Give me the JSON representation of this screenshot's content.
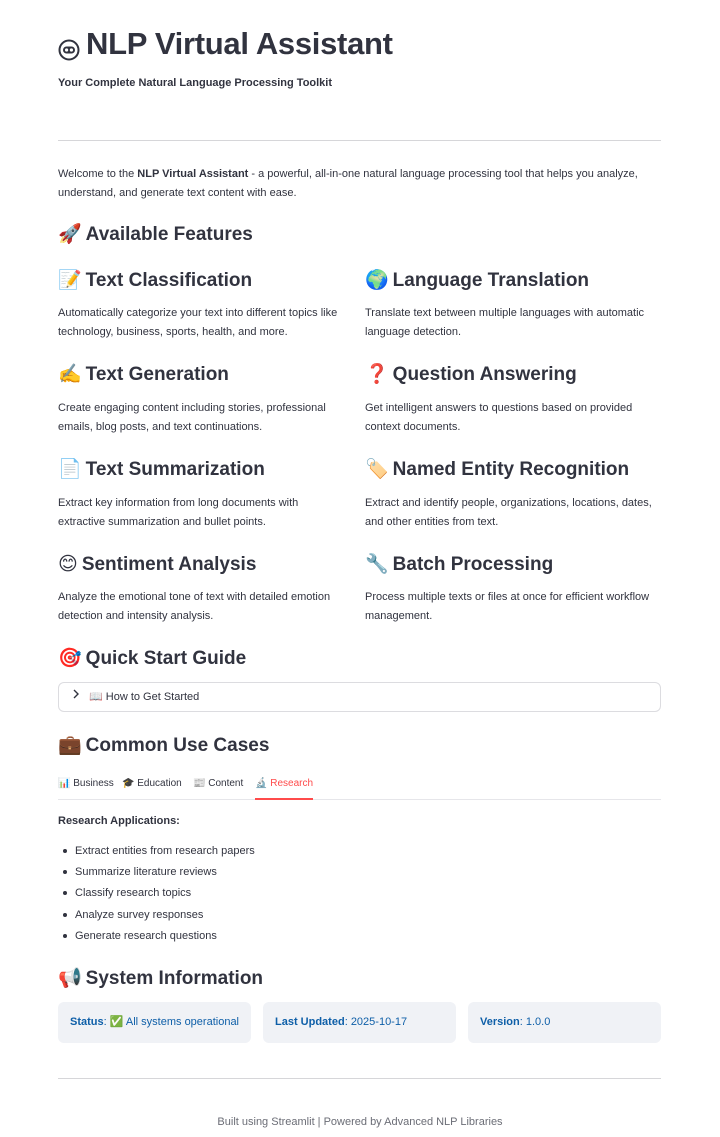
{
  "header": {
    "title": "NLP Virtual Assistant",
    "subtitle": "Your Complete Natural Language Processing Toolkit",
    "icon": "robot-icon"
  },
  "intro": {
    "prefix": "Welcome to the ",
    "bold": "NLP Virtual Assistant",
    "line1_rest": " - a powerful, all-in-one natural language processing tool that helps you analyze,",
    "line2": "understand, and generate text content with ease."
  },
  "features": {
    "heading_emoji": "🚀",
    "heading": "Available Features",
    "items": [
      {
        "emoji": "📝",
        "title": "Text Classification",
        "line1": "Automatically categorize your text into different topics like",
        "line2": "technology, business, sports, health, and more."
      },
      {
        "emoji": "🌍",
        "title": "Language Translation",
        "line1": "Translate text between multiple languages with automatic",
        "line2": "language detection."
      },
      {
        "emoji": "✍️",
        "title": "Text Generation",
        "line1": "Create engaging content including stories, professional",
        "line2": "emails, blog posts, and text continuations."
      },
      {
        "emoji": "❓",
        "title": "Question Answering",
        "line1": "Get intelligent answers to questions based on provided",
        "line2": "context documents."
      },
      {
        "emoji": "📄",
        "title": "Text Summarization",
        "line1": "Extract key information from long documents with",
        "line2": "extractive summarization and bullet points."
      },
      {
        "emoji": "🏷️",
        "title": "Named Entity Recognition",
        "line1": "Extract and identify people, organizations, locations, dates,",
        "line2": "and other entities from text."
      },
      {
        "emoji": "😊",
        "title": "Sentiment Analysis",
        "line1": "Analyze the emotional tone of text with detailed emotion",
        "line2": "detection and intensity analysis."
      },
      {
        "emoji": "🔧",
        "title": "Batch Processing",
        "line1": "Process multiple texts or files at once for efficient workflow",
        "line2": "management."
      }
    ]
  },
  "quick_start": {
    "heading_emoji": "🎯",
    "heading": "Quick Start Guide",
    "expander_label": "📖 How to Get Started"
  },
  "use_cases": {
    "heading_emoji": "💼",
    "heading": "Common Use Cases",
    "tabs": [
      "📊 Business",
      "🎓 Education",
      "📰 Content",
      "🔬 Research"
    ],
    "active_tab": "🔬 Research",
    "section_title": "Research Applications:",
    "items": [
      "Extract entities from research papers",
      "Summarize literature reviews",
      "Classify research topics",
      "Analyze survey responses",
      "Generate research questions"
    ]
  },
  "system_info": {
    "heading_emoji": "📢",
    "heading": "System Information",
    "status_label": "Status",
    "status_value": "✅ All systems operational",
    "updated_label": "Last Updated",
    "updated_value": "2025-10-17",
    "version_label": "Version",
    "version_value": "1.0.0"
  },
  "footer": {
    "text": "Built using Streamlit | Powered by Advanced NLP Libraries"
  },
  "colors": {
    "accent": "#ff4b4b",
    "info_bg": "#f0f2f6",
    "info_text": "#0e5fa8",
    "text": "#31333f"
  }
}
